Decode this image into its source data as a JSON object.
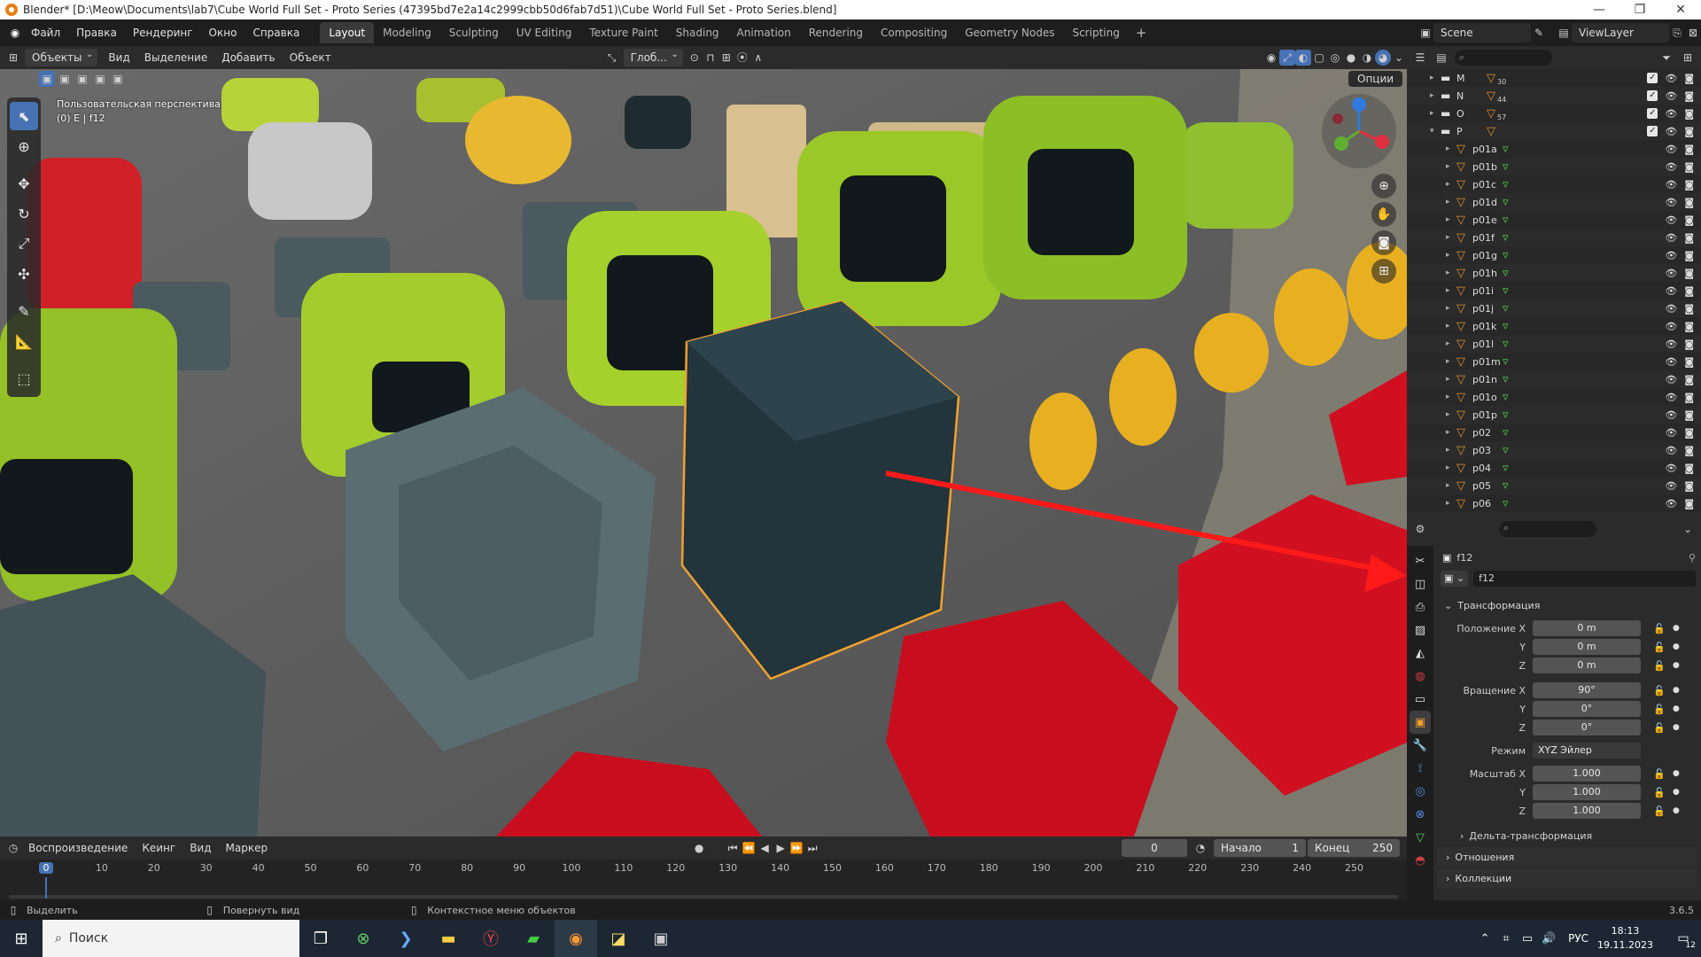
{
  "window": {
    "title": "Blender* [D:\\Meow\\Documents\\lab7\\Cube World Full Set - Proto Series (47395bd7e2a14c2999cbb50d6fab7d51)\\Cube World Full Set - Proto Series.blend]",
    "min": "—",
    "max": "❐",
    "close": "✕"
  },
  "menu": {
    "items": [
      "Файл",
      "Правка",
      "Рендеринг",
      "Окно",
      "Справка"
    ],
    "workspaces": [
      "Layout",
      "Modeling",
      "Sculpting",
      "UV Editing",
      "Texture Paint",
      "Shading",
      "Animation",
      "Rendering",
      "Compositing",
      "Geometry Nodes",
      "Scripting"
    ],
    "active_workspace": "Layout",
    "add_tab": "+",
    "scene": "Scene",
    "view_layer": "ViewLayer"
  },
  "viewport_header": {
    "mode": "Объекты",
    "menus": [
      "Вид",
      "Выделение",
      "Добавить",
      "Объект"
    ],
    "orientation": "Глоб...",
    "options": "Опции"
  },
  "viewport": {
    "info_line1": "Пользовательская перспектива",
    "info_line2": "(0) E | f12"
  },
  "outliner": {
    "search_placeholder": "",
    "collections": [
      {
        "name": "M",
        "count": "30"
      },
      {
        "name": "N",
        "count": "44"
      },
      {
        "name": "O",
        "count": "57"
      },
      {
        "name": "P",
        "count": ""
      }
    ],
    "objects": [
      "p01a",
      "p01b",
      "p01c",
      "p01d",
      "p01e",
      "p01f",
      "p01g",
      "p01h",
      "p01i",
      "p01j",
      "p01k",
      "p01l",
      "p01m",
      "p01n",
      "p01o",
      "p01p",
      "p02",
      "p03",
      "p04",
      "p05",
      "p06"
    ]
  },
  "properties": {
    "object_name": "f12",
    "datablock_name": "f12",
    "section_transform": "Трансформация",
    "loc_label": "Положение X",
    "loc": [
      "0 m",
      "0 m",
      "0 m"
    ],
    "rot_label": "Вращение X",
    "rot": [
      "90°",
      "0°",
      "0°"
    ],
    "mode_label": "Режим",
    "mode_value": "XYZ Эйлер",
    "scale_label": "Масштаб X",
    "scale": [
      "1.000",
      "1.000",
      "1.000"
    ],
    "axis_y": "Y",
    "axis_z": "Z",
    "delta": "Дельта-трансформация",
    "relations": "Отношения",
    "collections": "Коллекции"
  },
  "timeline": {
    "menus": [
      "Воспроизведение",
      "Кеинг",
      "Вид",
      "Маркер"
    ],
    "current_frame": "0",
    "start_label": "Начало",
    "start": "1",
    "end_label": "Конец",
    "end": "250",
    "ticks": [
      "0",
      "10",
      "20",
      "30",
      "40",
      "50",
      "60",
      "70",
      "80",
      "90",
      "100",
      "110",
      "120",
      "130",
      "140",
      "150",
      "160",
      "170",
      "180",
      "190",
      "200",
      "210",
      "220",
      "230",
      "240",
      "250"
    ]
  },
  "statusbar": {
    "select": "Выделить",
    "rotate": "Повернуть вид",
    "context": "Контекстное меню объектов",
    "version": "3.6.5"
  },
  "taskbar": {
    "search": "Поиск",
    "lang": "РУС",
    "time": "18:13",
    "date": "19.11.2023",
    "notif": "12"
  },
  "colors": {
    "accent": "#4772b3",
    "selected_outline": "#f0a030",
    "arrow": "#ff1a1a"
  }
}
